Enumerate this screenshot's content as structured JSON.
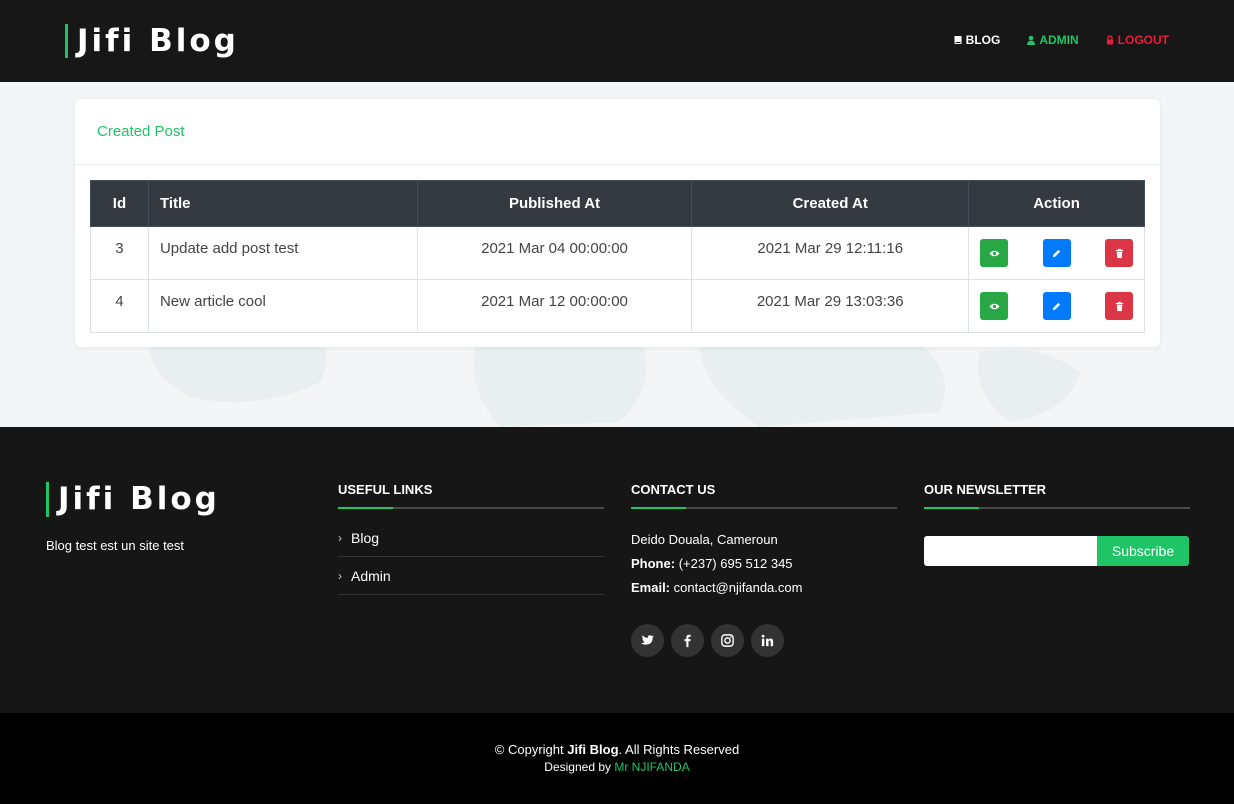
{
  "header": {
    "brand": "Jifi Blog",
    "nav": {
      "blog": "BLOG",
      "admin": "ADMIN",
      "logout": "LOGOUT"
    }
  },
  "card": {
    "title": "Created Post",
    "table": {
      "headers": [
        "Id",
        "Title",
        "Published At",
        "Created At",
        "Action"
      ],
      "rows": [
        {
          "id": "3",
          "title": "Update add post test",
          "published_at": "2021 Mar 04 00:00:00",
          "created_at": "2021 Mar 29 12:11:16"
        },
        {
          "id": "4",
          "title": "New article cool",
          "published_at": "2021 Mar 12 00:00:00",
          "created_at": "2021 Mar 29 13:03:36"
        }
      ]
    }
  },
  "footer": {
    "brand": "Jifi Blog",
    "description": "Blog test est un site test",
    "useful_links": {
      "title": "USEFUL LINKS",
      "items": [
        "Blog",
        "Admin"
      ]
    },
    "contact": {
      "title": "CONTACT US",
      "address": "Deido Douala, Cameroun",
      "phone_label": "Phone:",
      "phone": "(+237) 695 512 345",
      "email_label": "Email:",
      "email": "contact@njifanda.com"
    },
    "newsletter": {
      "title": "OUR NEWSLETTER",
      "input_value": "",
      "button": "Subscribe"
    },
    "socials": [
      "twitter-icon",
      "facebook-icon",
      "instagram-icon",
      "linkedin-icon"
    ],
    "copyright_prefix": "© Copyright",
    "copyright_brand": "Jifi Blog",
    "copyright_suffix": ". All Rights Reserved",
    "designed_prefix": "Designed by",
    "designed_author": "Mr NJIFANDA"
  },
  "colors": {
    "accent": "#1ec465",
    "logout": "#ec1b3b",
    "view": "#28a745",
    "edit": "#007bff",
    "delete": "#dc3545",
    "table_header": "#343a40"
  }
}
